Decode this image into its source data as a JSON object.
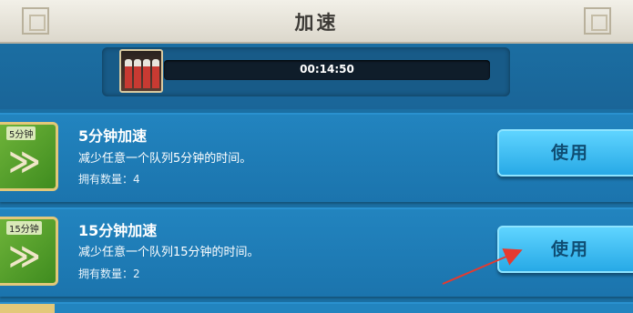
{
  "window": {
    "title": "加速"
  },
  "queue": {
    "time_remaining": "00:14:50",
    "progress": 0.0
  },
  "items": [
    {
      "icon_label": "5分钟",
      "name": "5分钟加速",
      "description": "减少任意一个队列5分钟的时间。",
      "quantity": "拥有数量：4",
      "button": "使用"
    },
    {
      "icon_label": "15分钟",
      "name": "15分钟加速",
      "description": "减少任意一个队列15分钟的时间。",
      "quantity": "拥有数量：2",
      "button": "使用"
    }
  ],
  "colors": {
    "annotation_arrow": "#e53a2f"
  }
}
